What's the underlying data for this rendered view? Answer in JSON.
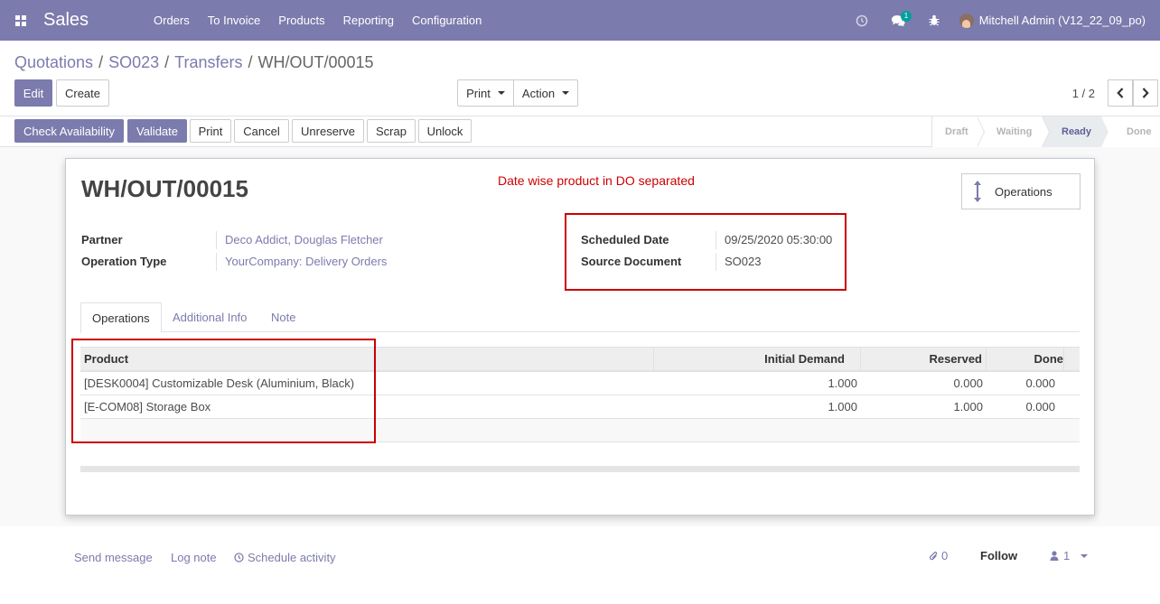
{
  "topbar": {
    "app_name": "Sales",
    "menu": [
      "Orders",
      "To Invoice",
      "Products",
      "Reporting",
      "Configuration"
    ],
    "chat_count": "1",
    "user_name": "Mitchell Admin (V12_22_09_po)"
  },
  "breadcrumb": {
    "items": [
      "Quotations",
      "SO023",
      "Transfers"
    ],
    "current": "WH/OUT/00015",
    "separator": "/"
  },
  "control_panel": {
    "edit_label": "Edit",
    "create_label": "Create",
    "print_label": "Print",
    "action_label": "Action",
    "pager": "1 / 2"
  },
  "status_buttons": {
    "check_availability": "Check Availability",
    "validate": "Validate",
    "print": "Print",
    "cancel": "Cancel",
    "unreserve": "Unreserve",
    "scrap": "Scrap",
    "unlock": "Unlock"
  },
  "status_steps": [
    "Draft",
    "Waiting",
    "Ready",
    "Done"
  ],
  "status_active": "Ready",
  "form": {
    "reference": "WH/OUT/00015",
    "note": "Date wise product in DO separated",
    "operations_button": "Operations",
    "partner_label": "Partner",
    "partner_value": "Deco Addict, Douglas Fletcher",
    "operation_type_label": "Operation Type",
    "operation_type_value": "YourCompany: Delivery Orders",
    "scheduled_date_label": "Scheduled Date",
    "scheduled_date_value": "09/25/2020 05:30:00",
    "source_document_label": "Source Document",
    "source_document_value": "SO023"
  },
  "tabs": [
    "Operations",
    "Additional Info",
    "Note"
  ],
  "table": {
    "headers": [
      "Product",
      "Initial Demand",
      "Reserved",
      "Done"
    ],
    "rows": [
      {
        "product": "[DESK0004] Customizable Desk (Aluminium, Black)",
        "initial_demand": "1.000",
        "reserved": "0.000",
        "done": "0.000"
      },
      {
        "product": "[E-COM08] Storage Box",
        "initial_demand": "1.000",
        "reserved": "1.000",
        "done": "0.000"
      }
    ]
  },
  "chatter": {
    "send_message": "Send message",
    "log_note": "Log note",
    "schedule_activity": "Schedule activity",
    "attachments": "0",
    "follow": "Follow",
    "followers": "1"
  },
  "colors": {
    "brand": "#7c7bad",
    "note_red": "#cc0000",
    "chat_badge": "#00a09d"
  }
}
